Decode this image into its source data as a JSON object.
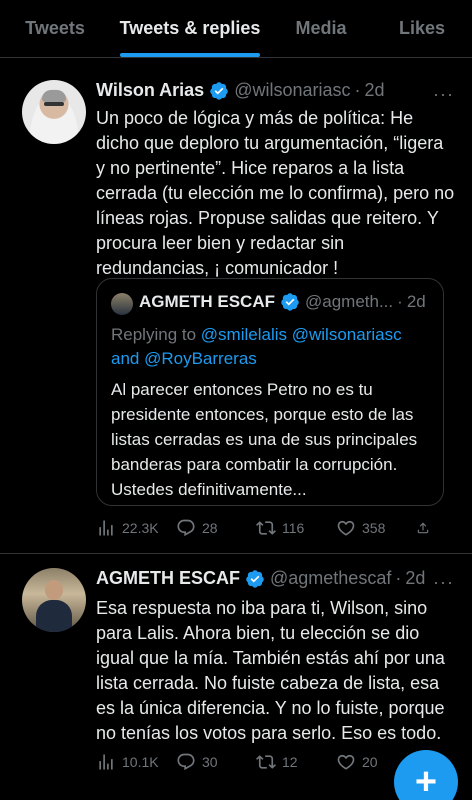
{
  "tabs": [
    {
      "label": "Tweets"
    },
    {
      "label": "Tweets & replies"
    },
    {
      "label": "Media"
    },
    {
      "label": "Likes"
    }
  ],
  "active_tab": "Tweets & replies",
  "colors": {
    "accent": "#1d9bf0",
    "background": "#000000",
    "text": "#e7e9ea",
    "muted": "#71767b",
    "border": "#2f3336"
  },
  "tweets": [
    {
      "name": "Wilson Arias",
      "handle": "@wilsonariasc",
      "date": "2d",
      "more": "···",
      "text": "Un poco de lógica y más de política:  He dicho que deploro tu argumentación, “ligera y no pertinente”. Hice reparos a la lista cerrada (tu elección me lo confirma), pero no líneas rojas. Propuse salidas que reitero. Y procura leer bien y redactar sin redundancias, ¡ comunicador !",
      "quote": {
        "name": "AGMETH ESCAF",
        "handle": "@agmeth...",
        "date": "2d",
        "replying_prefix": "Replying to",
        "mention1": "@smilelalis",
        "mention2": "@wilsonariasc",
        "and": "and",
        "mention3": "@RoyBarreras",
        "text": "Al parecer entonces Petro no es tu presidente entonces, porque esto de las listas cerradas es una de sus principales banderas para combatir la corrupción. Ustedes definitivamente..."
      },
      "stats": {
        "views": "22.3K",
        "replies": "28",
        "retweets": "116",
        "likes": "358"
      }
    },
    {
      "name": "AGMETH ESCAF",
      "handle": "@agmethescaf",
      "date": "2d",
      "more": "···",
      "text": "Esa respuesta no iba para ti, Wilson, sino para Lalis. Ahora bien, tu elección se dio igual que la mía. También estás ahí por una lista cerrada. No fuiste cabeza de lista, esa es la única diferencia. Y no lo fuiste, porque no tenías los votos para serlo. Eso es todo.",
      "stats": {
        "views": "10.1K",
        "replies": "30",
        "retweets": "12",
        "likes": "20"
      }
    }
  ],
  "fab": {
    "label": "+"
  }
}
